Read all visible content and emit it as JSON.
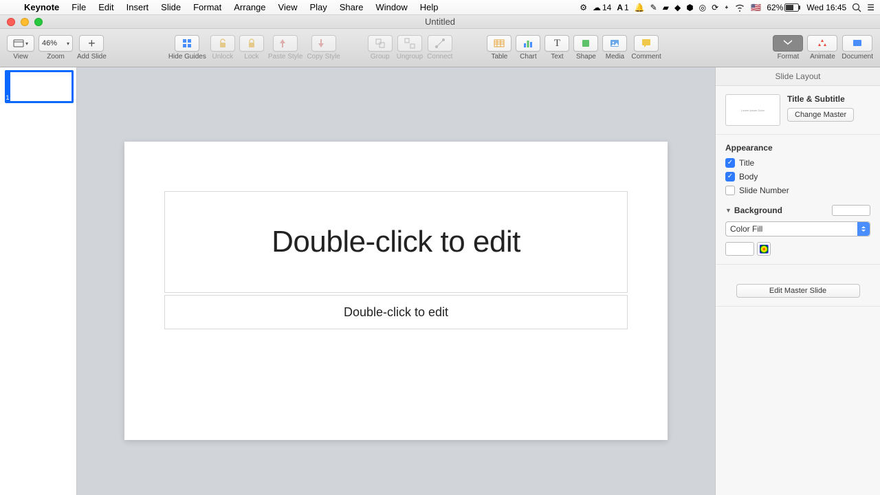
{
  "menubar": {
    "app": "Keynote",
    "items": [
      "File",
      "Edit",
      "Insert",
      "Slide",
      "Format",
      "Arrange",
      "View",
      "Play",
      "Share",
      "Window",
      "Help"
    ],
    "status": {
      "cc_badge": "14",
      "ai_badge": "1",
      "battery_pct": "62%",
      "clock": "Wed 16:45",
      "flag": "🇺🇸"
    }
  },
  "window": {
    "title": "Untitled"
  },
  "toolbar": {
    "view": "View",
    "zoom": "Zoom",
    "zoom_value": "46%",
    "add_slide": "Add Slide",
    "hide_guides": "Hide Guides",
    "unlock": "Unlock",
    "lock": "Lock",
    "paste_style": "Paste Style",
    "copy_style": "Copy Style",
    "group": "Group",
    "ungroup": "Ungroup",
    "connect": "Connect",
    "table": "Table",
    "chart": "Chart",
    "text": "Text",
    "shape": "Shape",
    "media": "Media",
    "comment": "Comment",
    "format": "Format",
    "animate": "Animate",
    "document": "Document"
  },
  "nav": {
    "slide1_num": "1"
  },
  "slide": {
    "title_placeholder": "Double-click to edit",
    "body_placeholder": "Double-click to edit"
  },
  "inspector": {
    "header": "Slide Layout",
    "master_preview": "Lorem Ipsum Dolor",
    "master_name": "Title & Subtitle",
    "change_master": "Change Master",
    "appearance": "Appearance",
    "title": "Title",
    "body": "Body",
    "slide_number": "Slide Number",
    "background": "Background",
    "fill_type": "Color Fill",
    "edit_master": "Edit Master Slide"
  }
}
